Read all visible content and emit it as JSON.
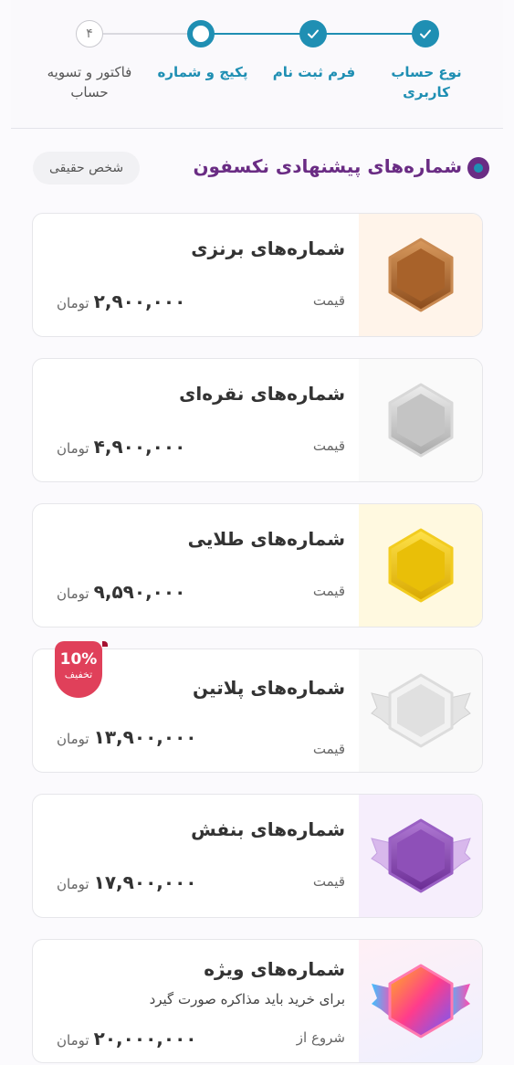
{
  "stepper": {
    "steps": [
      {
        "label": "نوع حساب کاربری",
        "status": "done"
      },
      {
        "label": "فرم ثبت نام",
        "status": "done"
      },
      {
        "label": "پکیج و شماره",
        "status": "active"
      },
      {
        "label": "فاکتور و تسویه حساب",
        "status": "todo",
        "number": "۴"
      }
    ]
  },
  "header": {
    "title": "شماره‌های پیشنهادی نکسفون",
    "person_type": "شخص حقیقی"
  },
  "cards": [
    {
      "title": "شماره‌های برنزی",
      "price_label": "قیمت",
      "price": "۲,۹۰۰,۰۰۰",
      "unit": "تومان",
      "color": "#b06a2c",
      "bg": "#fff5ea"
    },
    {
      "title": "شماره‌های نقره‌ای",
      "price_label": "قیمت",
      "price": "۴,۹۰۰,۰۰۰",
      "unit": "تومان",
      "color": "#c8c8c8",
      "bg": "#fbfbfb"
    },
    {
      "title": "شماره‌های طلایی",
      "price_label": "قیمت",
      "price": "۹,۵۹۰,۰۰۰",
      "unit": "تومان",
      "color": "#e8c000",
      "bg": "#fff9e0"
    },
    {
      "title": "شماره‌های پلاتین",
      "price_label": "قیمت",
      "price": "۱۳,۹۰۰,۰۰۰",
      "unit": "تومان",
      "color": "#dcdcdc",
      "bg": "#fafafa",
      "discount": {
        "percent": "10%",
        "label": "تخفیف"
      }
    },
    {
      "title": "شماره‌های بنفش",
      "price_label": "قیمت",
      "price": "۱۷,۹۰۰,۰۰۰",
      "unit": "تومان",
      "color": "#8a4cb4",
      "bg": "#f6eefc"
    },
    {
      "title": "شماره‌های ویژه",
      "subtitle": "برای خرید باید مذاکره صورت گیرد",
      "price_label": "شروع از",
      "price": "۲۰,۰۰۰,۰۰۰",
      "unit": "تومان",
      "color": "#ff3c8c",
      "bg": "#f4f0ff"
    }
  ]
}
